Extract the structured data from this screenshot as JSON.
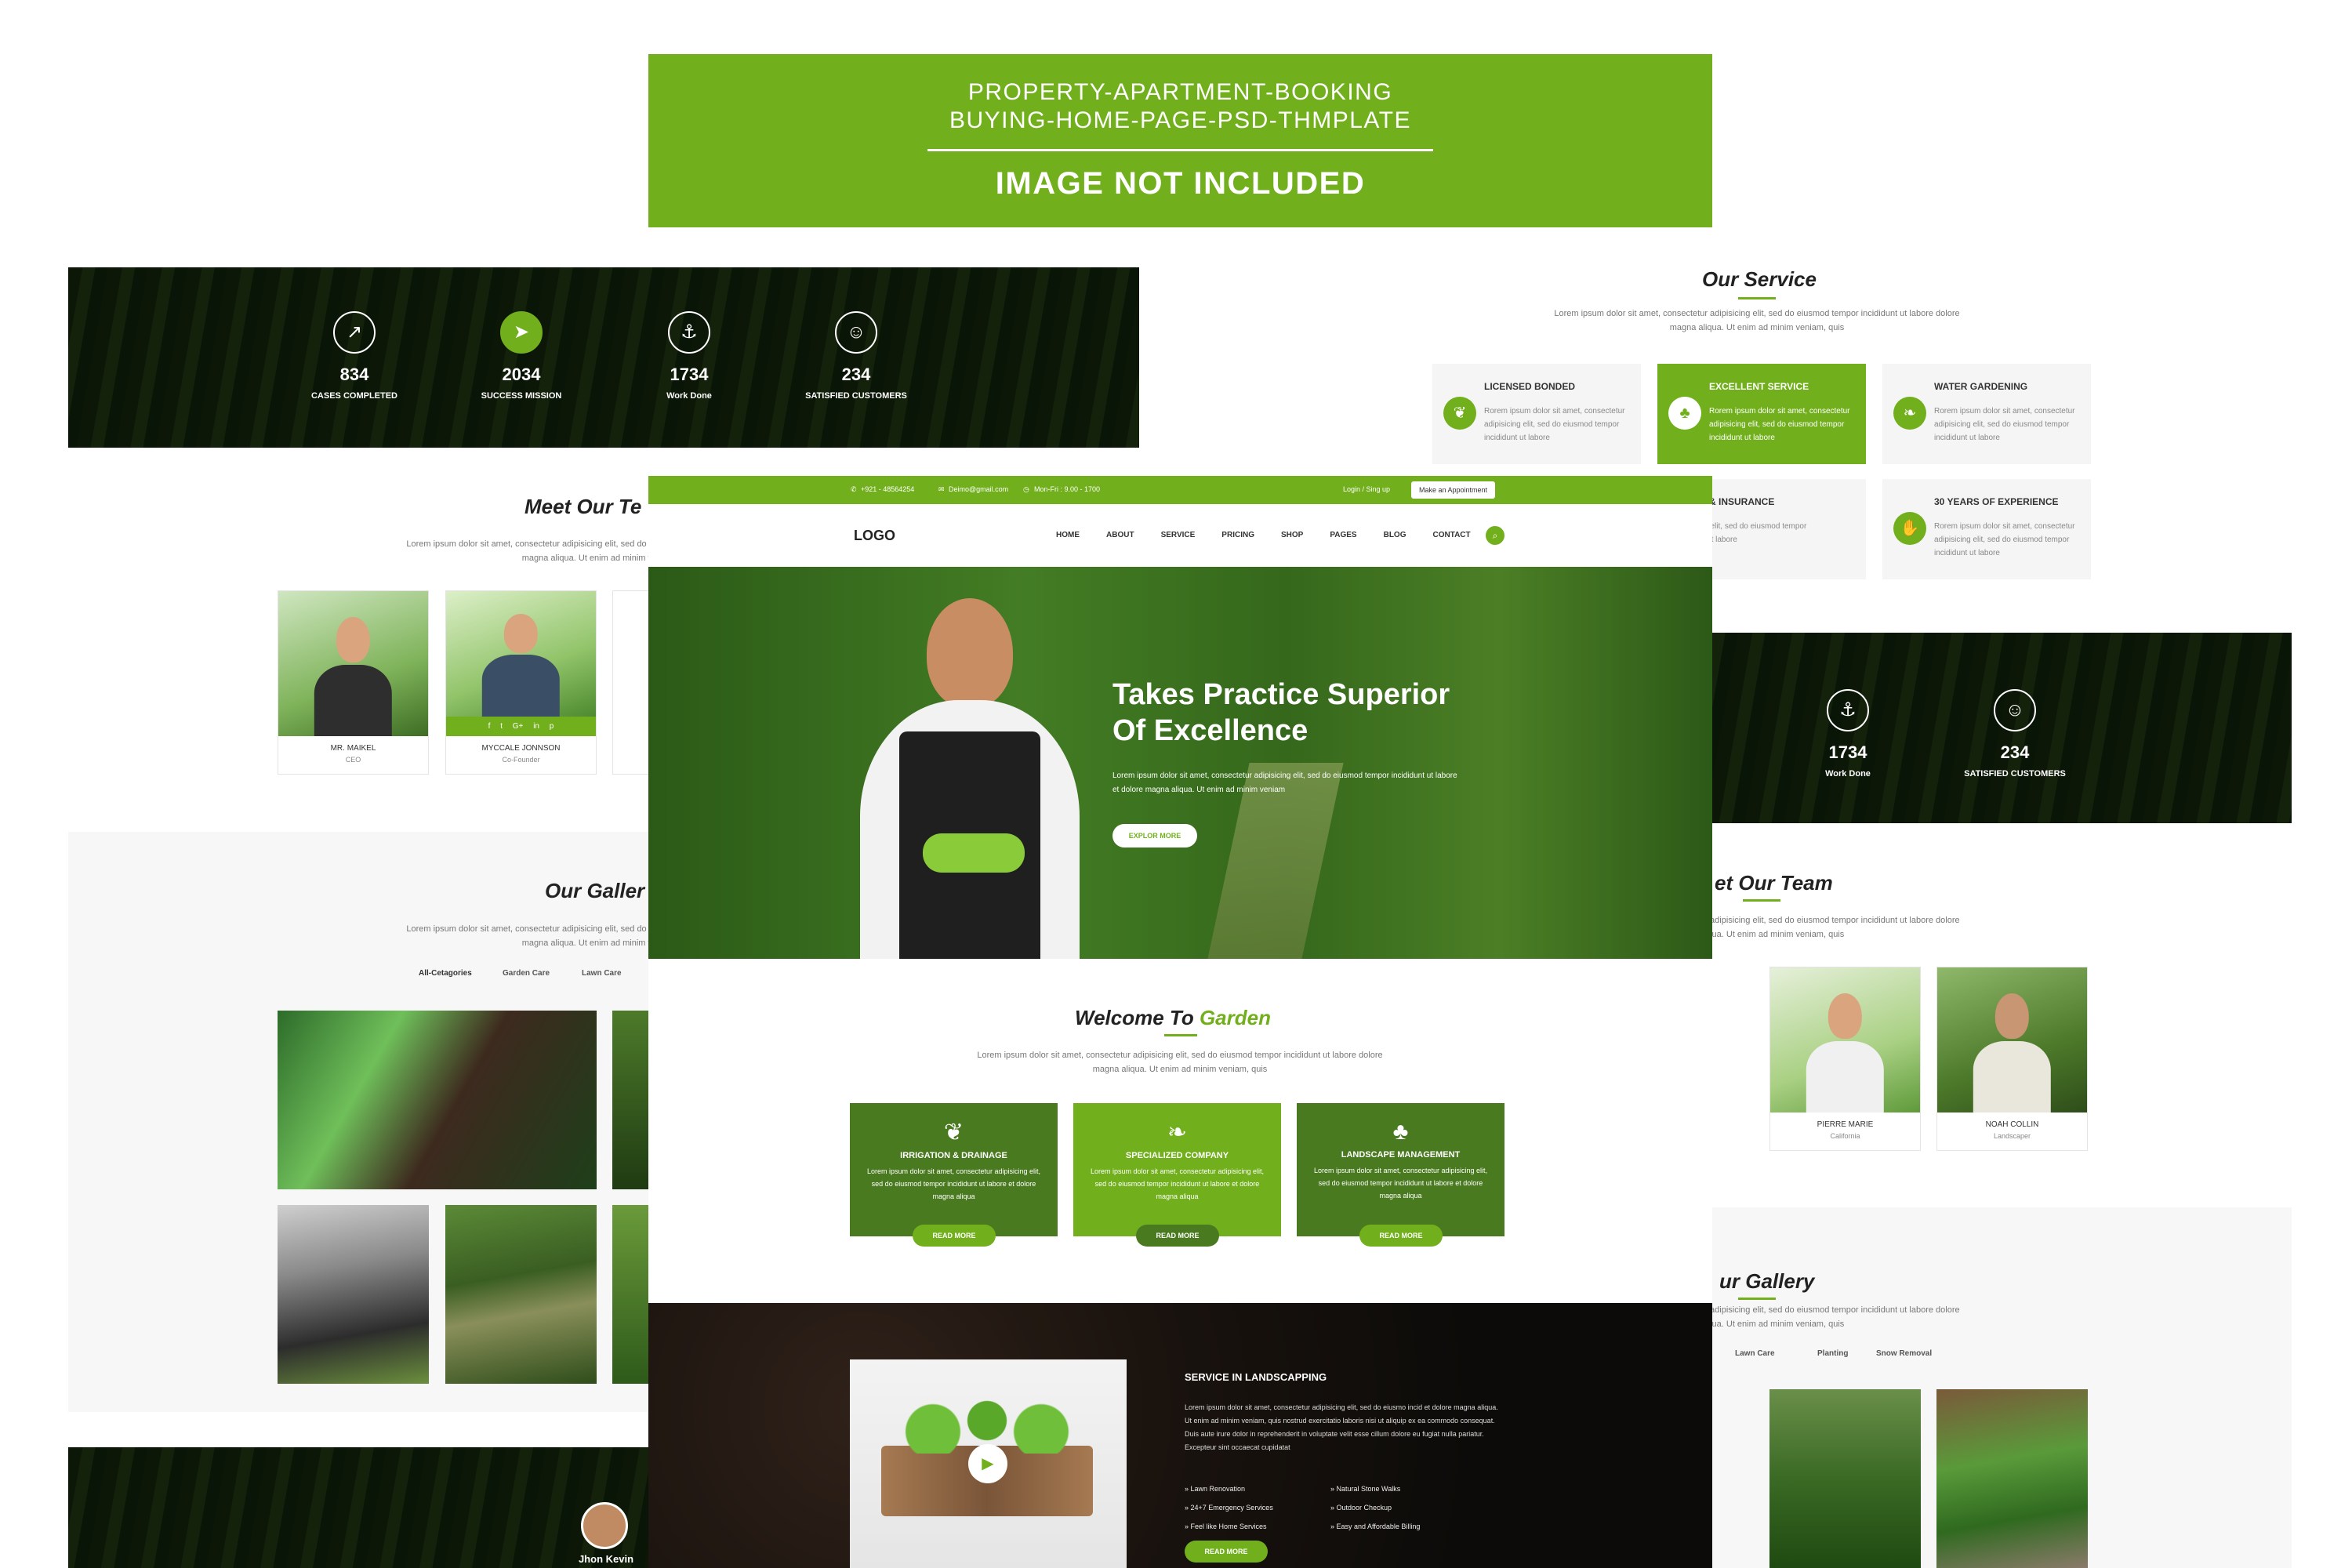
{
  "banner": {
    "line1": "PROPERTY-APARTMENT-BOOKING",
    "line2": "BUYING-HOME-PAGE-PSD-THMPLATE",
    "line3": "IMAGE NOT INCLUDED"
  },
  "colors": {
    "accent": "#71b01c",
    "dark_green": "#4a7a1f",
    "text": "#222222"
  },
  "stats_left": [
    {
      "icon": "chart-icon",
      "number": "834",
      "label": "CASES COMPLETED"
    },
    {
      "icon": "rocket-icon",
      "number": "2034",
      "label": "SUCCESS MISSION"
    },
    {
      "icon": "anchor-icon",
      "number": "1734",
      "label": "Work Done"
    },
    {
      "icon": "smile-icon",
      "number": "234",
      "label": "SATISFIED CUSTOMERS"
    }
  ],
  "stats_right": [
    {
      "icon": "anchor-icon",
      "number": "1734",
      "label": "Work Done"
    },
    {
      "icon": "smile-icon",
      "number": "234",
      "label": "SATISFIED CUSTOMERS"
    }
  ],
  "lorem_short": "Lorem ipsum dolor sit amet, consectetur adipisicing elit, sed do eiusmod tempor incididunt ut labore dolore magna aliqua. Ut enim ad minim veniam, quis",
  "left_page": {
    "team_title": "Meet Our Te",
    "team": [
      {
        "name": "MR. MAIKEL",
        "role": "CEO"
      },
      {
        "name": "MYCCALE JONNSON",
        "role": "Co-Founder"
      }
    ],
    "social": [
      "f",
      "t",
      "G+",
      "in",
      "p"
    ],
    "gallery_title": "Our Galler",
    "gallery_tabs": [
      "All-Cetagories",
      "Garden Care",
      "Lawn Care"
    ],
    "testimonial_name": "Jhon Kevin"
  },
  "right_page": {
    "service_title": "Our Service",
    "services": [
      {
        "title": "LICENSED BONDED",
        "desc": "Rorem ipsum dolor sit amet, consectetur adipisicing elit, sed do eiusmod tempor incididunt ut labore",
        "active": false
      },
      {
        "title": "EXCELLENT SERVICE",
        "desc": "Rorem ipsum dolor sit amet, consectetur adipisicing elit, sed do eiusmod tempor incididunt ut labore",
        "active": true
      },
      {
        "title": "WATER GARDENING",
        "desc": "Rorem ipsum dolor sit amet, consectetur adipisicing elit, sed do eiusmod tempor incididunt ut labore",
        "active": false
      },
      {
        "title": "ICENSE & INSURANCE",
        "desc": "adipisicing elit, sed do eiusmod tempor incididunt ut labore",
        "active": false
      },
      {
        "title": "30 YEARS OF EXPERIENCE",
        "desc": "Rorem ipsum dolor sit amet, consectetur adipisicing elit, sed do eiusmod tempor incididunt ut labore",
        "active": false
      }
    ],
    "team_title": "et Our Team",
    "team": [
      {
        "name": "PIERRE MARIE",
        "role": "California"
      },
      {
        "name": "NOAH COLLIN",
        "role": "Landscaper"
      }
    ],
    "gallery_title": "ur Gallery",
    "gallery_tabs": [
      "Lawn Care",
      "Planting",
      "Snow Removal"
    ]
  },
  "main_page": {
    "topbar": {
      "phone": "+921 - 48564254",
      "email": "Deimo@gmail.com",
      "hours": "Mon-Fri : 9.00 - 1700",
      "login": "Login / Sing up",
      "appointment": "Make an Appointment"
    },
    "logo": "LOGO",
    "nav": [
      "HOME",
      "ABOUT",
      "SERVICE",
      "PRICING",
      "SHOP",
      "PAGES",
      "BLOG",
      "CONTACT"
    ],
    "hero": {
      "title1": "Takes Practice Superior",
      "title2": "Of Excellence",
      "text": "Lorem ipsum dolor sit amet, consectetur adipisicing elit, sed do eiusmod tempor incididunt ut labore et dolore magna aliqua. Ut enim ad minim veniam",
      "button": "EXPLOR MORE"
    },
    "welcome": {
      "title": "Welcome To",
      "title_accent": "Garden",
      "sub": "Lorem ipsum dolor sit amet, consectetur adipisicing elit, sed do eiusmod tempor incididunt ut labore dolore magna aliqua. Ut enim ad minim veniam, quis"
    },
    "features": [
      {
        "icon": "leaf-icon",
        "title": "IRRIGATION & DRAINAGE",
        "desc": "Lorem ipsum dolor sit amet, consectetur adipisicing elit, sed do eiusmod tempor incididunt ut labore et dolore magna aliqua",
        "button": "READ MORE"
      },
      {
        "icon": "leaf-icon",
        "title": "SPECIALIZED COMPANY",
        "desc": "Lorem ipsum dolor sit amet, consectetur adipisicing elit, sed do eiusmod tempor incididunt ut labore et dolore magna aliqua",
        "button": "READ MORE"
      },
      {
        "icon": "tree-icon",
        "title": "LANDSCAPE MANAGEMENT",
        "desc": "Lorem ipsum dolor sit amet, consectetur adipisicing elit, sed do eiusmod tempor incididunt ut labore et dolore magna aliqua",
        "button": "READ MORE"
      }
    ],
    "landscaping": {
      "title": "SERVICE IN LANDSCAPPING",
      "text": "Lorem ipsum dolor sit amet, consectetur adipisicing elit, sed do eiusmo incid et dolore magna aliqua. Ut enim ad minim veniam, quis nostrud exercitatio laboris nisi ut aliquip ex ea commodo consequat. Duis aute irure dolor in reprehenderit in voluptate velit esse cillum dolore eu fugiat nulla pariatur. Excepteur sint occaecat cupidatat",
      "list_left": [
        "Lawn Renovation",
        "24+7 Emergency Services",
        "Feel like Home Services"
      ],
      "list_right": [
        "Natural Stone Walks",
        "Outdoor Checkup",
        "Easy and Affordable Billing"
      ],
      "button": "READ MORE"
    }
  }
}
